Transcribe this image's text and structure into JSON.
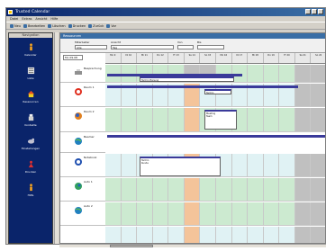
{
  "window": {
    "title": "Trusted Calendar"
  },
  "menu": [
    "Datei",
    "Extras",
    "Ansicht",
    "Hilfe"
  ],
  "toolbar": [
    {
      "label": "Neu"
    },
    {
      "label": "Bearbeiten"
    },
    {
      "label": "Löschen"
    },
    {
      "label": "Drucken"
    },
    {
      "label": "Zurück"
    },
    {
      "label": "Vor"
    }
  ],
  "sidebar": {
    "title": "Navigation",
    "items": [
      {
        "label": "Kalender",
        "icon": "person-icon"
      },
      {
        "label": "Liste",
        "icon": "list-icon"
      },
      {
        "label": "Ressourcen",
        "icon": "house-icon"
      },
      {
        "label": "Kontakte",
        "icon": "chess-icon"
      },
      {
        "label": "Einstellungen",
        "icon": "animal-icon"
      },
      {
        "label": "Drucken",
        "icon": "figure-icon"
      },
      {
        "label": "Hilfe",
        "icon": "person-icon"
      }
    ]
  },
  "main": {
    "header": "Ressourcen",
    "filters": [
      {
        "label": "Mitarbeiter",
        "value": "Alle"
      },
      {
        "label": "Ansicht",
        "value": "Tag"
      },
      {
        "label": "Von",
        "value": ""
      },
      {
        "label": "Bis",
        "value": ""
      }
    ],
    "date_select": "Mo 09.08",
    "days": [
      "Mo 9",
      "Di 10",
      "Mi 11",
      "Do 12",
      "Fr 13",
      "Sa 14",
      "So 15",
      "Mo 16",
      "Di 17",
      "Mi 18",
      "Do 19",
      "Fr 20",
      "Sa 21",
      "So 22"
    ],
    "resources": [
      {
        "name": "Besprechung",
        "icon": "printer-icon"
      },
      {
        "name": "Raum 1",
        "icon": "ie-icon"
      },
      {
        "name": "Raum 2",
        "icon": "firefox-icon"
      },
      {
        "name": "Beamer",
        "icon": "globe-icon"
      },
      {
        "name": "Notebook",
        "icon": "ie-blue-icon"
      },
      {
        "name": "Auto 1",
        "icon": "world-icon"
      },
      {
        "name": "Auto 2",
        "icon": "globe-icon"
      }
    ],
    "appointments": [
      {
        "title": "Termin",
        "note": "Planung"
      },
      {
        "title": "Termin",
        "note": ""
      },
      {
        "title": "Meeting",
        "note": "Team"
      },
      {
        "title": "Termin",
        "note": "Kunde"
      }
    ]
  },
  "colors": {
    "title_bar": "#0a246a",
    "sidebar": "#0a246a",
    "free": "#ccead0",
    "weekend": "#c0c0c0",
    "holiday": "#f4c49a"
  }
}
